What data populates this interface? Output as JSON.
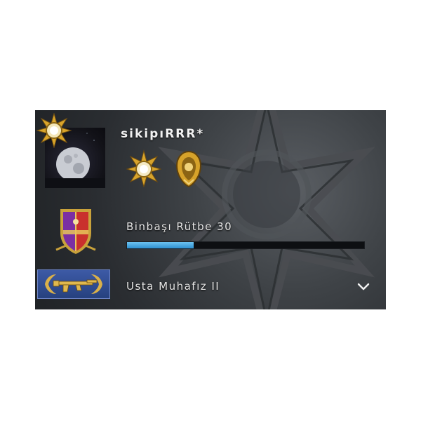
{
  "profile": {
    "username": "sikipıRRR*"
  },
  "rank": {
    "label": "Binbaşı Rütbe 30",
    "progress_percent": 28
  },
  "skill_group": {
    "label": "Usta Muhafız II"
  },
  "colors": {
    "progress_fill": "#3a9be0",
    "progress_track": "#0d0f12",
    "skill_badge": "#2e4a92",
    "card_background": "#34383c"
  },
  "icons": {
    "corner_medal": "service-medal-icon",
    "medal_1": "service-medal-icon",
    "medal_2": "coin-medal-icon",
    "rank": "rank-shield-icon",
    "skill": "rifle-laurel-icon",
    "expand": "chevron-down-icon"
  }
}
